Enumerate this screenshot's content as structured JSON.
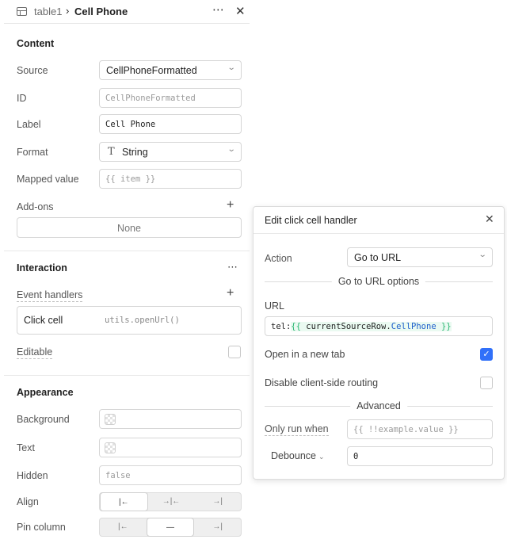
{
  "header": {
    "parent": "table1",
    "separator": "›",
    "name": "Cell Phone",
    "more_icon": "⋯",
    "close_icon": "✕"
  },
  "content": {
    "title": "Content",
    "source": {
      "label": "Source",
      "value": "CellPhoneFormatted"
    },
    "id": {
      "label": "ID",
      "placeholder": "CellPhoneFormatted"
    },
    "label_field": {
      "label": "Label",
      "value": "Cell Phone"
    },
    "format": {
      "label": "Format",
      "icon": "T",
      "value": "String"
    },
    "mapped_value": {
      "label": "Mapped value",
      "placeholder": "{{ item }}"
    },
    "addons": {
      "label": "Add-ons",
      "add_icon": "+",
      "none_label": "None"
    }
  },
  "interaction": {
    "title": "Interaction",
    "more_icon": "⋯",
    "event_handlers_label": "Event handlers",
    "add_icon": "+",
    "handlers": [
      {
        "event": "Click cell",
        "action": "utils.openUrl()"
      }
    ],
    "editable": {
      "label": "Editable",
      "checked": false
    }
  },
  "appearance": {
    "title": "Appearance",
    "background": {
      "label": "Background"
    },
    "text": {
      "label": "Text"
    },
    "hidden": {
      "label": "Hidden",
      "placeholder": "false"
    },
    "align": {
      "label": "Align",
      "options": [
        "|←",
        "→|←",
        "→|"
      ],
      "selected": 0
    },
    "pin_column": {
      "label": "Pin column",
      "options": [
        "|←",
        "—",
        "→|"
      ],
      "selected": 1
    }
  },
  "popover": {
    "title": "Edit click cell handler",
    "close_icon": "✕",
    "action": {
      "label": "Action",
      "value": "Go to URL"
    },
    "options_heading": "Go to URL options",
    "url": {
      "label": "URL",
      "prefix": "tel:",
      "open_bracket": "{{ ",
      "variable": "currentSourceRow",
      "dot": ".",
      "property": "CellPhone",
      "close_bracket": " }}"
    },
    "new_tab": {
      "label": "Open in a new tab",
      "checked": true,
      "check_icon": "✓"
    },
    "disable_routing": {
      "label": "Disable client-side routing",
      "checked": false
    },
    "advanced_heading": "Advanced",
    "only_run_when": {
      "label": "Only run when",
      "placeholder": "{{ !!example.value }}"
    },
    "debounce": {
      "label": "Debounce",
      "chevron": "⌄",
      "value": "0"
    }
  },
  "colors": {
    "accent": "#3170f9",
    "border": "#d6d6d6",
    "muted_text": "#555555"
  }
}
